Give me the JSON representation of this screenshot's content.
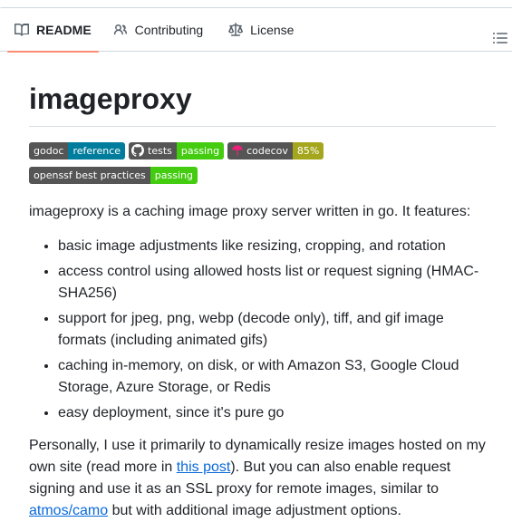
{
  "tabs": [
    {
      "label": "README",
      "icon": "book-icon",
      "active": true
    },
    {
      "label": "Contributing",
      "icon": "people-icon",
      "active": false
    },
    {
      "label": "License",
      "icon": "law-scale-icon",
      "active": false
    }
  ],
  "toc_icon": "list-unordered-icon",
  "readme": {
    "title": "imageproxy",
    "badges": {
      "godoc": {
        "left": "godoc",
        "right": "reference",
        "color": "#007d9c"
      },
      "tests": {
        "left": "tests",
        "right": "passing",
        "color": "#4c1",
        "icon": "github-icon"
      },
      "codecov": {
        "left": "codecov",
        "right": "85%",
        "color": "#a4a61d",
        "icon": "codecov-umbrella-icon"
      },
      "openssf": {
        "left": "openssf best practices",
        "right": "passing",
        "color": "#4c1"
      }
    },
    "intro": "imageproxy is a caching image proxy server written in go. It features:",
    "features": [
      "basic image adjustments like resizing, cropping, and rotation",
      "access control using allowed hosts list or request signing (HMAC-SHA256)",
      "support for jpeg, png, webp (decode only), tiff, and gif image formats (including animated gifs)",
      "caching in-memory, on disk, or with Amazon S3, Google Cloud Storage, Azure Storage, or Redis",
      "easy deployment, since it's pure go"
    ],
    "para": {
      "part1": "Personally, I use it primarily to dynamically resize images hosted on my own site (read more in ",
      "link1": "this post",
      "part2": "). But you can also enable request signing and use it as an SSL proxy for remote images, similar to ",
      "link2": "atmos/camo",
      "part3": " but with additional image adjustment options."
    }
  }
}
